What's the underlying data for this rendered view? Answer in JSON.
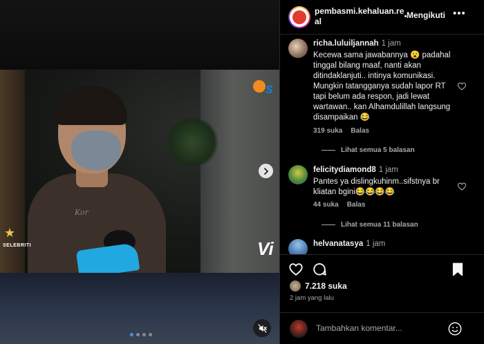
{
  "media": {
    "shirt_print": "Kor",
    "channel_label": "SELEBRITI",
    "logo_text": "Vi",
    "carousel": {
      "total": 4,
      "active": 0
    }
  },
  "header": {
    "username": "pembasmi.kehaluan.real",
    "follow_label": "Mengikuti",
    "more_label": "•••"
  },
  "comments": [
    {
      "user": "richa.luluiljannah",
      "time": "1 jam",
      "text": "Kecewa sama jawabannya 😮 padahal tinggal bilang maaf, nanti akan ditindaklanjuti.. intinya komunikasi. Mungkin tatangganya sudah lapor RT tapi belum ada respon, jadi lewat wartawan.. kan Alhamdulillah langsung disampaikan 😂",
      "likes": "319 suka",
      "reply": "Balas",
      "replies": "Lihat semua 5 balasan",
      "avatar_color": "#8a6a5a"
    },
    {
      "user": "felicitydiamond8",
      "time": "1 jam",
      "text": "Pantes ya dislingkuhinm..sifstnya br kliatan bgini😂😂😂😂",
      "likes": "44 suka",
      "reply": "Balas",
      "replies": "Lihat semua 11 balasan",
      "avatar_color": "#4f8a3a"
    },
    {
      "user": "helvanatasya",
      "time": "1 jam",
      "text": "",
      "avatar_color": "#4a7ab0"
    }
  ],
  "actions": {
    "likes": "7.218 suka",
    "timestamp": "2 jam yang lalu"
  },
  "add_comment": {
    "placeholder": "Tambahkan komentar..."
  },
  "colors": {
    "background": "#000000",
    "text_primary": "#f5f5f5",
    "text_secondary": "#a8a8a8",
    "divider": "#262626",
    "accent_carousel": "#4a90e2"
  },
  "icons": [
    "chevron-right-icon",
    "mute-icon",
    "heart-icon",
    "comment-icon",
    "share-icon",
    "bookmark-icon",
    "emoji-icon",
    "more-icon"
  ]
}
